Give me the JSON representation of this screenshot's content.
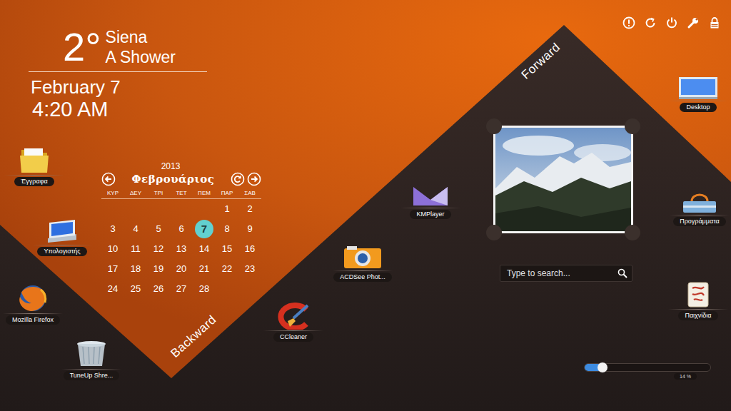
{
  "weather": {
    "temperature": "2°",
    "city": "Siena",
    "condition": "A Shower"
  },
  "clock": {
    "date": "February 7",
    "time": "4:20 AM"
  },
  "calendar": {
    "year": "2013",
    "month": "Φεβρουάριος",
    "weekdays": [
      "ΚΥΡ",
      "ΔΕΥ",
      "ΤΡΙ",
      "ΤΕΤ",
      "ΠΕΜ",
      "ΠΑΡ",
      "ΣΑΒ"
    ],
    "weeks": [
      [
        null,
        null,
        null,
        null,
        null,
        {
          "day": "1",
          "selected": false
        },
        {
          "day": "2",
          "selected": false
        }
      ],
      [
        {
          "day": "3",
          "selected": false
        },
        {
          "day": "4",
          "selected": false
        },
        {
          "day": "5",
          "selected": false
        },
        {
          "day": "6",
          "selected": false
        },
        {
          "day": "7",
          "selected": true
        },
        {
          "day": "8",
          "selected": false
        },
        {
          "day": "9",
          "selected": false
        }
      ],
      [
        {
          "day": "10",
          "selected": false
        },
        {
          "day": "11",
          "selected": false
        },
        {
          "day": "12",
          "selected": false
        },
        {
          "day": "13",
          "selected": false
        },
        {
          "day": "14",
          "selected": false
        },
        {
          "day": "15",
          "selected": false
        },
        {
          "day": "16",
          "selected": false
        }
      ],
      [
        {
          "day": "17",
          "selected": false
        },
        {
          "day": "18",
          "selected": false
        },
        {
          "day": "19",
          "selected": false
        },
        {
          "day": "20",
          "selected": false
        },
        {
          "day": "21",
          "selected": false
        },
        {
          "day": "22",
          "selected": false
        },
        {
          "day": "23",
          "selected": false
        }
      ],
      [
        {
          "day": "24",
          "selected": false
        },
        {
          "day": "25",
          "selected": false
        },
        {
          "day": "26",
          "selected": false
        },
        {
          "day": "27",
          "selected": false
        },
        {
          "day": "28",
          "selected": false
        },
        null,
        null
      ]
    ]
  },
  "nav": {
    "forward": "Forward",
    "backward": "Backward"
  },
  "desktop_icons": [
    {
      "label": "Έγγραφα",
      "kind": "folder"
    },
    {
      "label": "Υπολογιστής",
      "kind": "computer"
    },
    {
      "label": "Mozilla Firefox",
      "kind": "firefox"
    },
    {
      "label": "TuneUp Shre...",
      "kind": "shredder"
    },
    {
      "label": "KMPlayer",
      "kind": "kmplayer"
    },
    {
      "label": "ACDSee Phot...",
      "kind": "camera"
    },
    {
      "label": "CCleaner",
      "kind": "ccleaner"
    },
    {
      "label": "Desktop",
      "kind": "desktop"
    },
    {
      "label": "Προγράμματα",
      "kind": "programs"
    },
    {
      "label": "Παιχνίδια",
      "kind": "games"
    }
  ],
  "search": {
    "placeholder": "Type to search..."
  },
  "volume": {
    "level": 0.14,
    "reading": "14 %"
  }
}
